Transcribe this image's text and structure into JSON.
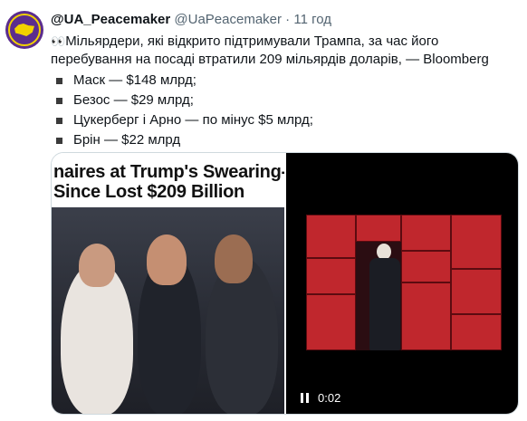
{
  "tweet": {
    "display_name": "@UA_Peacemaker",
    "handle": "@UaPeacemaker",
    "separator": "·",
    "time": "11 год",
    "emoji": "👀",
    "text_line1": "Мільярдери, які відкрито підтримували Трампа, за час його",
    "text_line2": "перебування на посаді втратили 209 мільярдів доларів, — Bloomberg",
    "bullets": [
      "Маск — $148 млрд;",
      "Безос — $29 млрд;",
      "Цукерберг і Арно — по мінус $5 млрд;",
      "Брін — $22 млрд"
    ]
  },
  "media": {
    "image_headline_line1": "naires at Trump's Swearing-In",
    "image_headline_line2": "Since Lost $209 Billion",
    "video_time": "0:02"
  },
  "icons": {
    "avatar": "avatar-logo",
    "pause": "pause-icon"
  },
  "colors": {
    "text": "#0f1419",
    "secondary": "#536471",
    "heatmap_red": "#c0272d"
  }
}
